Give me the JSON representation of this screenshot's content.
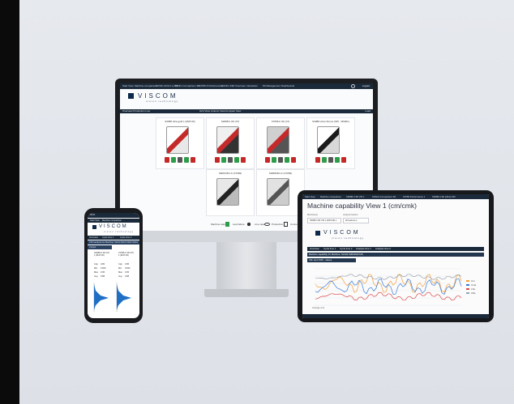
{
  "monitor": {
    "topbar_tabs": [
      "Start View",
      "Machine comparison",
      "SONIC-SOLO vs SX",
      "SONIC-Comparison 3D",
      "S7055-S Performance",
      "SONIC-X3D Overview",
      "Interaction",
      "PA Management",
      "Dashboards"
    ],
    "logout": "Logout",
    "logo": "VISCOM",
    "logo_sub": "vision technology",
    "nav": {
      "left": "Overview Production Line",
      "mid": [
        "Grid View",
        "Column View",
        "Compact View"
      ],
      "right": "Load"
    },
    "machines": [
      {
        "name": "S3088 ultra gold 1 (MAT-06)",
        "colors": [
          "#ffffff",
          "#c42a2a",
          "#e8e8e8"
        ]
      },
      {
        "name": "S3088-II 3D (X7)",
        "colors": [
          "#f0f0f0",
          "#c42a2a",
          "#333333"
        ]
      },
      {
        "name": "X7056-II 3D (X7)",
        "colors": [
          "#d0d0d0",
          "#c42a2a",
          "#555555"
        ]
      },
      {
        "name": "S3088 ultra chrome (SPI - M6061)",
        "colors": [
          "#ffffff",
          "#1a1a1a",
          "#d8d8d8"
        ]
      },
      {
        "name": "S6053 BO-X (X7056)",
        "colors": [
          "#e8e8e8",
          "#222222",
          "#bbbbbb"
        ]
      },
      {
        "name": "S3088 BO-X (X7056)",
        "colors": [
          "#e2e2e2",
          "#555555",
          "#cccccc"
        ]
      }
    ],
    "legend": [
      "Machine status",
      "Last failure",
      "Live view",
      "Production",
      "Connection"
    ]
  },
  "phone": {
    "status": "09:41",
    "bar": [
      "Start View",
      "Machine comparison"
    ],
    "logo": "VISCOM",
    "logo_sub": "vision technology",
    "nav": [
      "Overview",
      "Cycle time 1",
      "Cycle time 2"
    ],
    "band": "CPU analysis for Machine: S3G3 S3G3 S3G3 S3G3",
    "section": "Cp/cpk",
    "col_a": "S3088-II 3D VIS 1 (MAT-06)",
    "col_b": "X7056-II 3D VIS 1 (MAT-06)",
    "rows": [
      [
        "Cpk",
        "0.85",
        "Cpk",
        "0.85"
      ],
      [
        "Min",
        "0.843",
        "Min",
        "0.843"
      ],
      [
        "Max",
        "0.95",
        "Max",
        "0.95"
      ],
      [
        "Avg",
        "0.88",
        "Avg",
        "0.88"
      ]
    ]
  },
  "tablet": {
    "tabs": [
      "Start View",
      "Machine comparison",
      "S3088-II 3D VIS 1",
      "SONIC-Comparison 3D",
      "S7055 Performance 1",
      "S3088-II 3D (Ultra) SPI"
    ],
    "title": "Machine capability View 1 (cm/cmk)",
    "filter1_label": "Machine(s)",
    "filter1_value": "S3088-II 3D VIS 1 (MAT-06) ▾",
    "filter2_label": "Analysis feature",
    "filter2_value": "All features ▾",
    "logo": "VISCOM",
    "logo_sub": "vision technology",
    "nav": [
      "Overview",
      "Cycle time 1",
      "Cycle time 2",
      "Analysis time 1",
      "Analysis time 2"
    ],
    "band1": "Machine capability for Machine: S3-M4-S0001MAT-06",
    "band2": "CM- and CMK - values",
    "chart_legend": [
      "Cm",
      "Cmk",
      "LSL",
      "USL"
    ],
    "chart_note": "Average cmk",
    "colors": {
      "blue": "#3a7bd5",
      "orange": "#f0a23a",
      "red": "#d94b4b",
      "gray": "#9aa3ad"
    }
  }
}
